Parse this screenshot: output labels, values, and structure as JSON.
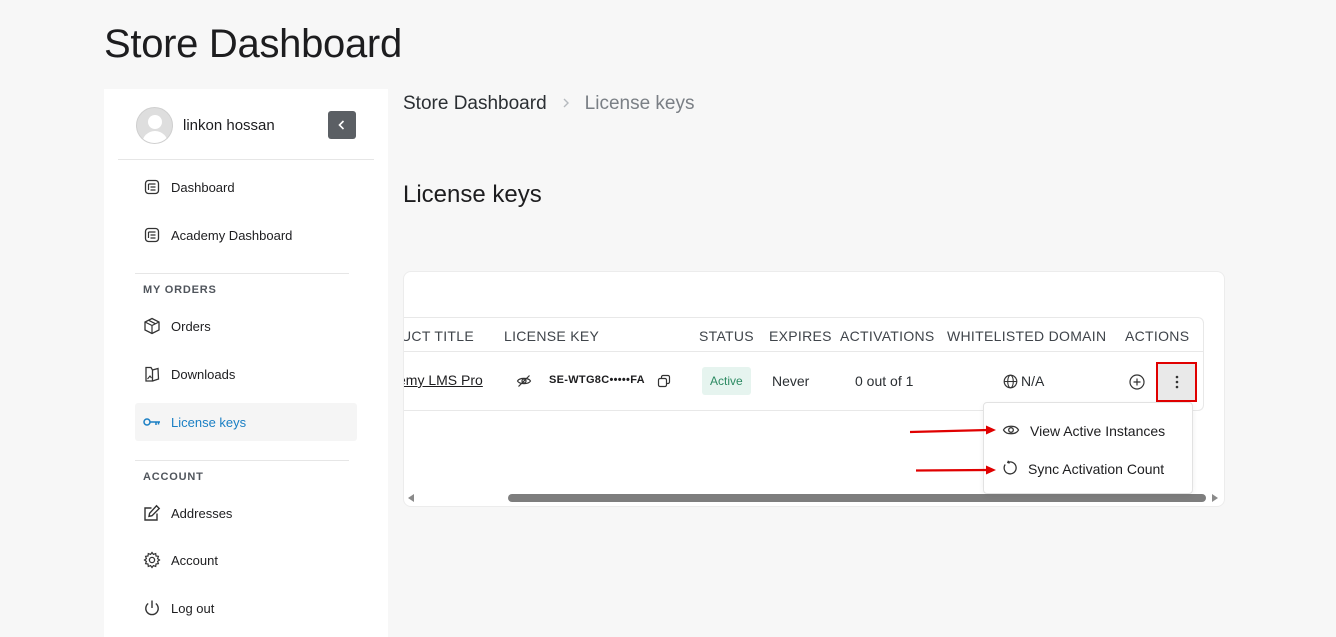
{
  "page": {
    "title": "Store Dashboard"
  },
  "sidebar": {
    "user_name": "linkon hossan",
    "nav_main": [
      {
        "label": "Dashboard",
        "icon": "dashboard-icon"
      },
      {
        "label": "Academy Dashboard",
        "icon": "dashboard-icon"
      }
    ],
    "section_orders": "MY ORDERS",
    "orders_items": [
      {
        "label": "Orders",
        "icon": "box-icon"
      },
      {
        "label": "Downloads",
        "icon": "download-icon"
      },
      {
        "label": "License keys",
        "icon": "key-icon",
        "active": true
      }
    ],
    "section_account": "ACCOUNT",
    "account_items": [
      {
        "label": "Addresses",
        "icon": "edit-icon"
      },
      {
        "label": "Account",
        "icon": "gear-icon"
      },
      {
        "label": "Log out",
        "icon": "power-icon"
      }
    ]
  },
  "breadcrumb": {
    "root": "Store Dashboard",
    "current": "License keys"
  },
  "main": {
    "section_title": "License keys"
  },
  "table": {
    "columns": [
      "UCT TITLE",
      "LICENSE KEY",
      "STATUS",
      "EXPIRES",
      "ACTIVATIONS",
      "WHITELISTED DOMAIN",
      "ACTIONS"
    ],
    "rows": [
      {
        "product": "emy LMS Pro",
        "license_key": "SE-WTG8C•••••FA",
        "status": "Active",
        "expires": "Never",
        "activations": "0 out of 1",
        "domain": "N/A"
      }
    ]
  },
  "dropdown": {
    "items": [
      {
        "label": "View Active Instances",
        "icon": "eye-icon"
      },
      {
        "label": "Sync Activation Count",
        "icon": "refresh-icon"
      }
    ]
  },
  "colors": {
    "accent": "#1a7fc4",
    "status_active_bg": "#e6f4ef",
    "status_active_text": "#2c8a62",
    "highlight_red": "#e00000"
  }
}
